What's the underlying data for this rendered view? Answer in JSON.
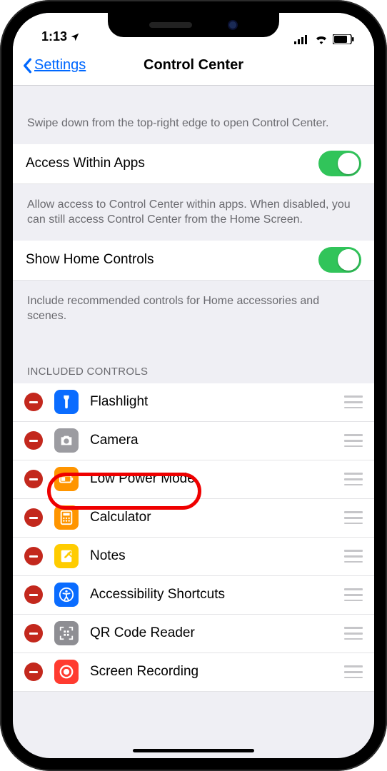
{
  "status": {
    "time": "1:13"
  },
  "nav": {
    "back": "Settings",
    "title": "Control Center"
  },
  "intro": "Swipe down from the top-right edge to open Control Center.",
  "setting1": {
    "label": "Access Within Apps",
    "desc": "Allow access to Control Center within apps. When disabled, you can still access Control Center from the Home Screen."
  },
  "setting2": {
    "label": "Show Home Controls",
    "desc": "Include recommended controls for Home accessories and scenes."
  },
  "included_header": "INCLUDED CONTROLS",
  "items": [
    {
      "label": "Flashlight",
      "bg": "#0a6cff",
      "icon": "flashlight"
    },
    {
      "label": "Camera",
      "bg": "#9c9ca1",
      "icon": "camera"
    },
    {
      "label": "Low Power Mode",
      "bg": "#ff9500",
      "icon": "battery"
    },
    {
      "label": "Calculator",
      "bg": "#ff9500",
      "icon": "calc"
    },
    {
      "label": "Notes",
      "bg": "#ffcc00",
      "icon": "notes"
    },
    {
      "label": "Accessibility Shortcuts",
      "bg": "#0a6cff",
      "icon": "access"
    },
    {
      "label": "QR Code Reader",
      "bg": "#8e8e93",
      "icon": "qr"
    },
    {
      "label": "Screen Recording",
      "bg": "#ff3b30",
      "icon": "record"
    }
  ]
}
